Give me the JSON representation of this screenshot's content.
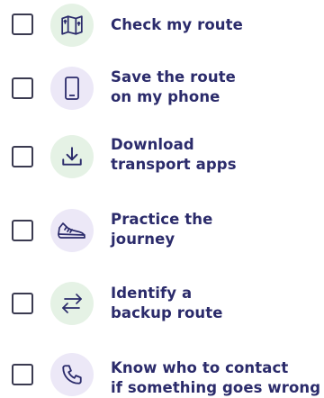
{
  "checklist": {
    "items": [
      {
        "lines": [
          "Check my route"
        ],
        "icon": "map-icon",
        "icon_bg": "#e5f2e5",
        "checked": false
      },
      {
        "lines": [
          "Save the route",
          "on my phone"
        ],
        "icon": "phone-icon",
        "icon_bg": "#ece8f7",
        "checked": false
      },
      {
        "lines": [
          "Download",
          "transport apps"
        ],
        "icon": "download-icon",
        "icon_bg": "#e5f2e5",
        "checked": false
      },
      {
        "lines": [
          "Practice the",
          "journey"
        ],
        "icon": "shoe-icon",
        "icon_bg": "#ece8f7",
        "checked": false
      },
      {
        "lines": [
          "Identify a",
          "backup route"
        ],
        "icon": "swap-arrows-icon",
        "icon_bg": "#e5f2e5",
        "checked": false
      },
      {
        "lines": [
          "Know who to contact",
          "if something goes wrong"
        ],
        "icon": "phone-handset-icon",
        "icon_bg": "#ece8f7",
        "checked": false
      }
    ]
  },
  "colors": {
    "label_text": "#2b2b6b",
    "icon_stroke": "#2b2b6b",
    "checkbox_border": "#3a3a50"
  }
}
